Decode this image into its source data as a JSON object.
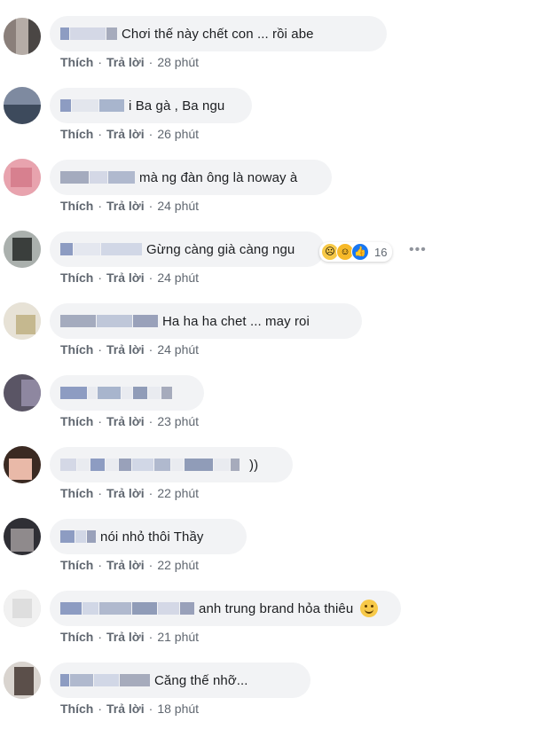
{
  "labels": {
    "like": "Thích",
    "reply": "Trả lời"
  },
  "comments": [
    {
      "text": "Chơi thế này chết con ... rồi abe",
      "time": "28 phút"
    },
    {
      "text": "i Ba gà , Ba ngu",
      "time": "26 phút"
    },
    {
      "text": "mà ng đàn ông là noway à",
      "time": "24 phút"
    },
    {
      "text": "Gừng càng già càng ngu",
      "time": "24 phút",
      "reaction_count": "16"
    },
    {
      "text": "Ha ha ha chet ... may roi",
      "time": "24 phút"
    },
    {
      "text": "",
      "time": "23 phút"
    },
    {
      "text": "))",
      "time": "22 phút"
    },
    {
      "text": "nói nhỏ thôi Thầy",
      "time": "22 phút"
    },
    {
      "text": "anh trung brand hỏa thiêu",
      "time": "21 phút"
    },
    {
      "text": "Căng thế nhỡ...",
      "time": "18 phút"
    }
  ],
  "colors": {
    "bubble": "#f2f3f5",
    "action_text": "#606770",
    "comment_text": "#1c1e21"
  }
}
